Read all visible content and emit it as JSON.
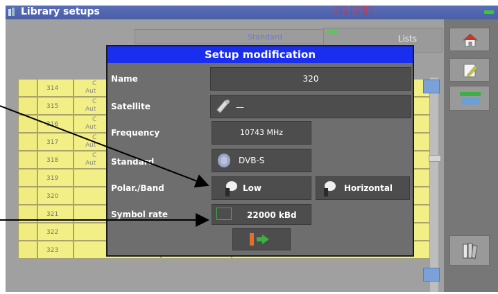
{
  "title_bar": {
    "title": "Library setups",
    "status_line1": "[?][?] [?][?][?]",
    "status_line2": "[?][?] [?][?][?]"
  },
  "top_bar": {
    "standard_label": "Standard",
    "lists_label": "Lists"
  },
  "rows": [
    {
      "num": "314",
      "sub": "Aut",
      "c": "C"
    },
    {
      "num": "315",
      "sub": "Aut",
      "c": "C"
    },
    {
      "num": "316",
      "sub": "Aut",
      "c": "C"
    },
    {
      "num": "317",
      "sub": "Aut",
      "c": "C"
    },
    {
      "num": "318",
      "sub": "Aut",
      "c": "C"
    },
    {
      "num": "319",
      "sub": "",
      "c": ""
    },
    {
      "num": "320",
      "sub": "",
      "c": ""
    },
    {
      "num": "321",
      "sub": "",
      "c": ""
    },
    {
      "num": "322",
      "sub": "",
      "c": ""
    },
    {
      "num": "323",
      "sub": "",
      "c": ""
    }
  ],
  "dialog": {
    "title": "Setup modification",
    "name_label": "Name",
    "name_value": "320",
    "satellite_label": "Satellite",
    "satellite_value": "—",
    "frequency_label": "Frequency",
    "frequency_value": "10743 MHz",
    "standard_label": "Standard",
    "standard_value": "DVB-S",
    "polar_band_label": "Polar./Band",
    "band_value": "Low",
    "polarization_value": "Horizontal",
    "symbol_rate_label": "Symbol rate",
    "symbol_rate_value": "22000 kBd"
  },
  "icons": {
    "home": "home-icon",
    "edit": "pen-edit-icon",
    "lnb": "lnb-icon",
    "library": "books-icon",
    "satellite_dish": "satellite-dish-icon",
    "ok_exit": "exit-arrow-icon"
  },
  "colors": {
    "title_bar": "#4b5fa8",
    "dialog_title": "#1a2ef0",
    "row_yellow": "#f3ef87",
    "panel_gray": "#777777"
  }
}
